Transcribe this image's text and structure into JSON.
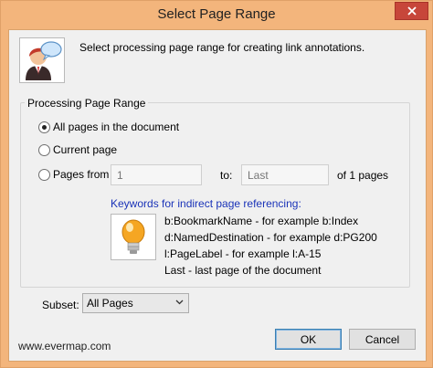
{
  "window": {
    "title": "Select Page Range"
  },
  "header": {
    "description": "Select processing page range for creating link annotations."
  },
  "group": {
    "label": "Processing Page Range",
    "options": {
      "all_pages": "All pages in the document",
      "current_page": "Current page",
      "pages_from": "Pages from"
    },
    "selected": "all_pages",
    "from_placeholder": "1",
    "to_label": "to:",
    "to_placeholder": "Last",
    "of_pages": "of 1 pages",
    "keywords_title": "Keywords for indirect page referencing:",
    "keywords": [
      "b:BookmarkName  -  for example b:Index",
      "d:NamedDestination  -  for example d:PG200",
      "l:PageLabel  -  for example l:A-15",
      "Last  -  last page of the document"
    ]
  },
  "subset": {
    "label": "Subset:",
    "value": "All Pages"
  },
  "footer": {
    "link": "www.evermap.com",
    "ok_label": "OK",
    "cancel_label": "Cancel"
  },
  "colors": {
    "frame": "#f3b57c",
    "close": "#c7463a",
    "keyword_title": "#1a33b8"
  }
}
